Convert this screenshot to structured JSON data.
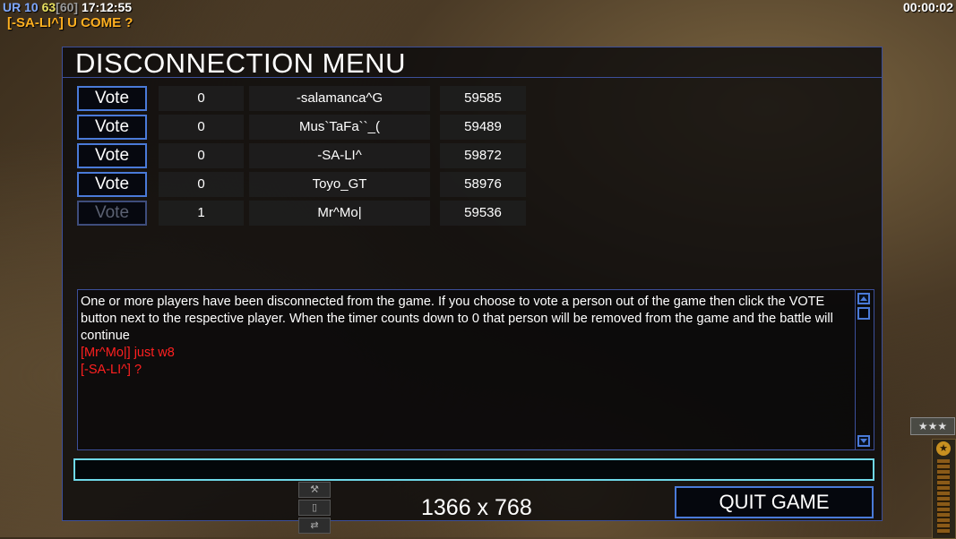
{
  "hud": {
    "faction": "UR",
    "stat1": "10",
    "stat2": "63",
    "stat3": "[60]",
    "clock": "17:12:55",
    "timer": "00:00:02",
    "message": "[-SA-LI^] U COME ?"
  },
  "dialog": {
    "title": "DISCONNECTION MENU",
    "players": [
      {
        "vote_label": "Vote",
        "votes": "0",
        "name": "-salamanca^G",
        "id": "59585",
        "enabled": true
      },
      {
        "vote_label": "Vote",
        "votes": "0",
        "name": "Mus`TaFa``_(",
        "id": "59489",
        "enabled": true
      },
      {
        "vote_label": "Vote",
        "votes": "0",
        "name": "-SA-LI^",
        "id": "59872",
        "enabled": true
      },
      {
        "vote_label": "Vote",
        "votes": "0",
        "name": "Toyo_GT",
        "id": "58976",
        "enabled": true
      },
      {
        "vote_label": "Vote",
        "votes": "1",
        "name": "Mr^Mo|",
        "id": "59536",
        "enabled": false
      }
    ],
    "chat": [
      {
        "text": "One or more players have been disconnected from the game. If you choose to vote a person out of the game then click the VOTE button next to the respective player. When the timer counts down to 0 that person will be removed from the game and the battle will continue",
        "color": "#ffffff"
      },
      {
        "text": "[Mr^Mo|] just w8",
        "color": "#ff2020"
      },
      {
        "text": "[-SA-LI^] ?",
        "color": "#ff2020"
      }
    ],
    "chat_input_value": "",
    "resolution": "1366 x 768",
    "quit_label": "QUIT GAME"
  },
  "colors": {
    "accent_border": "#4a7ad8",
    "input_border": "#6fd8e8",
    "chat_red": "#ff2020",
    "hud_message": "#ffb020"
  },
  "icons": {
    "scroll_up": "triangle-up-icon",
    "scroll_down": "triangle-down-icon",
    "rank": "stars-icon",
    "power": "star-icon"
  }
}
